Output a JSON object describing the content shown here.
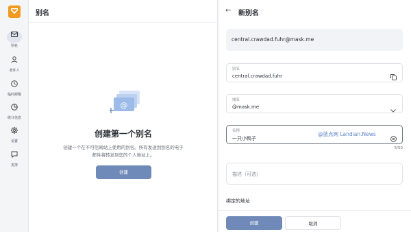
{
  "nav": {
    "items": [
      {
        "label": "别名",
        "icon": "mail-icon",
        "active": true
      },
      {
        "label": "收件人",
        "icon": "person-icon",
        "active": false
      },
      {
        "label": "临时邮箱",
        "icon": "clock-icon",
        "active": false
      },
      {
        "label": "统计信息",
        "icon": "pie-chart-icon",
        "active": false
      },
      {
        "label": "设置",
        "icon": "gear-icon",
        "active": false
      },
      {
        "label": "支持",
        "icon": "chat-icon",
        "active": false
      }
    ]
  },
  "left_pane": {
    "title": "别名",
    "empty_title": "创建第一个别名",
    "empty_desc": "创建一个在不可信网站上使用的别名。所有发送到别名的电子邮件将转发到您的个人地址上。",
    "create_label": "创建"
  },
  "right_pane": {
    "title": "新别名",
    "preview": "central.crawdad.fuhr@mask.me",
    "alias_field": {
      "label": "别名",
      "value": "central.crawdad.fuhr"
    },
    "domain_field": {
      "label": "域名",
      "value": "@mask.me"
    },
    "name_field": {
      "label": "名称",
      "value": "一只小鸭子",
      "counter": "5/50"
    },
    "desc_field": {
      "placeholder": "描述（可选）"
    },
    "bound_section": "绑定的地址",
    "create_label": "创建",
    "cancel_label": "取消"
  },
  "watermark": "@蓝点网 Landian.News",
  "colors": {
    "accent": "#6f8ab8",
    "logo": "#f29a1f"
  }
}
